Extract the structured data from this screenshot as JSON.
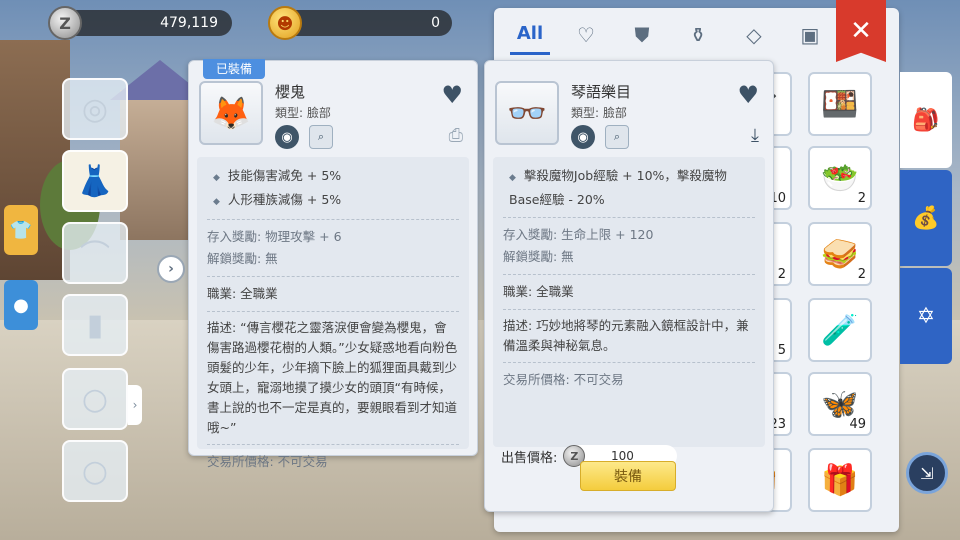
{
  "currency": {
    "zeny_icon": "Z",
    "zeny_value": "479,119",
    "gem_value": "0"
  },
  "inventory_tabs": [
    "All",
    "heart-icon",
    "shirt-icon",
    "potion-icon",
    "diamond-icon",
    "card-icon"
  ],
  "tab_all_label": "All",
  "left_panel": {
    "equipped_tag": "已裝備",
    "name": "櫻鬼",
    "type": "類型: 臉部",
    "effects": [
      "技能傷害減免 + 5%",
      "人形種族減傷 + 5%"
    ],
    "deposit_reward": "存入獎勵: 物理攻擊 + 6",
    "unlock_reward": "解鎖獎勵: 無",
    "job": "職業: 全職業",
    "description": "描述: “傳言櫻花之靈落淚便會變為櫻鬼，會傷害路過櫻花樹的人類。”少女疑惑地看向粉色頭髮的少年，少年摘下臉上的狐狸面具戴到少女頭上，寵溺地摸了摸少女的頭頂“有時候，書上說的也不一定是真的，要親眼看到才知道哦~”",
    "trade_price": "交易所價格: 不可交易"
  },
  "right_panel": {
    "name": "琴語樂目",
    "type": "類型: 臉部",
    "effect": "擊殺魔物Job經驗 + 10%，擊殺魔物Base經驗 - 20%",
    "deposit_reward": "存入獎勵: 生命上限 + 120",
    "unlock_reward": "解鎖獎勵: 無",
    "job": "職業: 全職業",
    "description": "描述: 巧妙地將琴的元素融入鏡框設計中，兼備溫柔與神秘氣息。",
    "trade_price": "交易所價格: 不可交易",
    "sell_label": "出售價格:",
    "sell_value": "100",
    "equip_button": "裝備"
  },
  "inventory_counts": {
    "c1": "",
    "c2": "10",
    "c3": "2",
    "c4": "2",
    "c5": "5",
    "c6": "23",
    "c7": "49",
    "c8": "2"
  },
  "icons": {
    "left_item": "fox-mask-icon",
    "right_item": "glasses-icon"
  },
  "colors": {
    "accent_blue": "#2a64c9",
    "close_red": "#d83a2c",
    "equip_yellow": "#f4cd3d",
    "equipped_tag": "#4d8fe0"
  }
}
